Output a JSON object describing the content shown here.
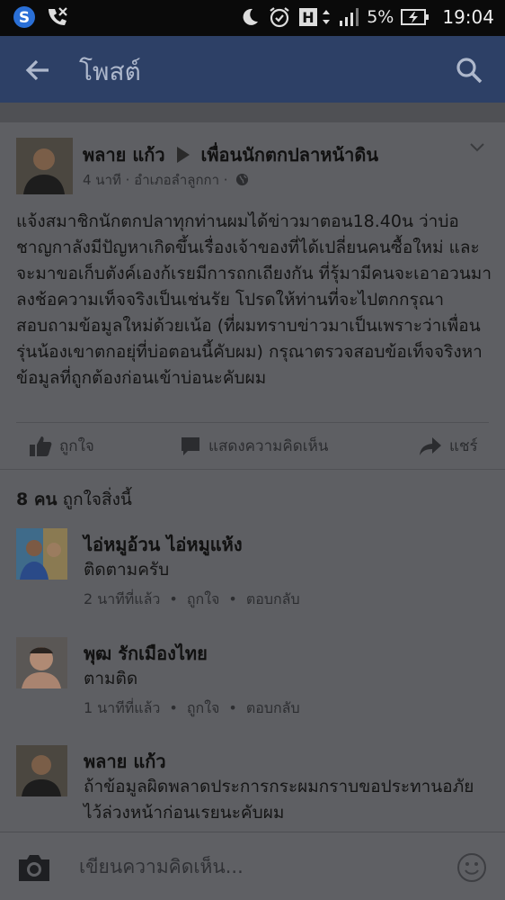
{
  "status_bar": {
    "left_icons": [
      "skype-icon",
      "missed-call-icon"
    ],
    "right_icons": [
      "moon-icon",
      "alarm-icon",
      "h-network-icon",
      "signal-icon"
    ],
    "battery": "5%",
    "time": "19:04"
  },
  "app_bar": {
    "title": "โพสต์"
  },
  "post": {
    "author": "พลาย แก้ว",
    "group": "เพื่อนนักตกปลาหน้าดิน",
    "meta": "4 นาที · อำเภอลำลูกกา ·",
    "body": "แจ้งสมาชิกนักตกปลาทุกท่านผมได้ข่าวมาตอน18.40น ว่าบ่อชาญกาลังมีปัญหาเกิดขึ้นเรื่องเจ้าของที่ได้เปลี่ยนคนซื้อใหม่ และจะมาขอเก็บตังค์เองก้เรยมีการถกเถียงกัน ที่รุ้มามีคนจะเอาอวนมาลงช้อความเท็จจริงเป็นเช่นรัย โปรดให้ท่านที่จะไปตกกรุณาสอบถามข้อมูลใหม่ด้วยเน้อ (ที่ผมทราบข่าวมาเป็นเพราะว่าเพื่อนรุ่นน้องเขาตกอยุ่ที่บ่อตอนนี้คับผม) กรุณาตรวจสอบข้อเท็จจริงหาข้อมูลที่ถูกต้องก่อนเข้าบ่อนะคับผม",
    "actions": {
      "like": "ถูกใจ",
      "comment": "แสดงความคิดเห็น",
      "share": "แชร์"
    }
  },
  "likes": {
    "count": "8 คน",
    "label": "ถูกใจสิ่งนี้"
  },
  "comments": [
    {
      "name": "ไอ่หมูอ้วน ไอ่หมูแห้ง",
      "text": "ติดตามครับ",
      "time": "2 นาทีที่แล้ว",
      "like": "ถูกใจ",
      "reply": "ตอบกลับ"
    },
    {
      "name": "พุฒ รักเมืองไทย",
      "text": "ตามติด",
      "time": "1 นาทีที่แล้ว",
      "like": "ถูกใจ",
      "reply": "ตอบกลับ"
    },
    {
      "name": "พลาย แก้ว",
      "text": "ถ้าข้อมูลผิดพลาดประการกระผมกราบขอประทานอภัยไว้ล่วงหน้าก่อนเรยนะคับผม"
    }
  ],
  "composer": {
    "placeholder": "เขียนความคิดเห็น..."
  }
}
